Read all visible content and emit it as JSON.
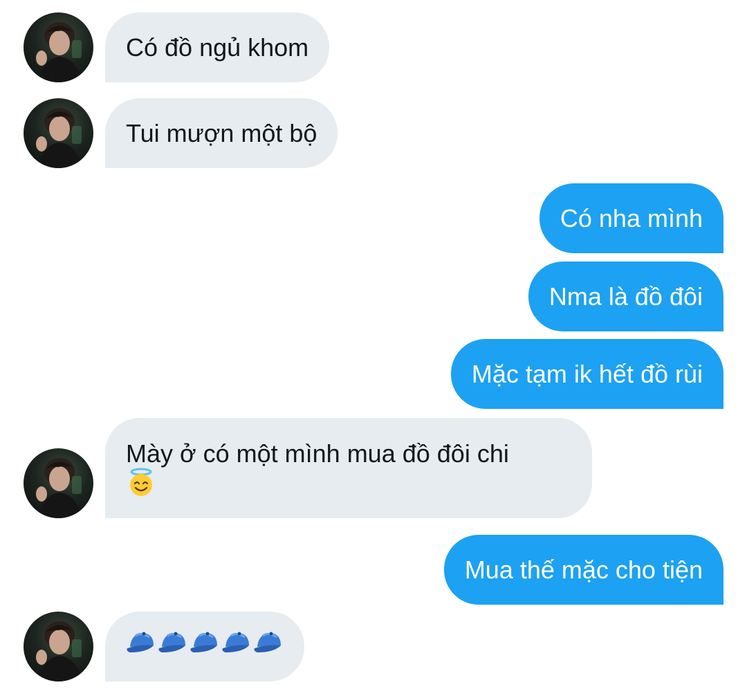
{
  "messages": [
    {
      "side": "incoming",
      "text": "Có đồ ngủ khom"
    },
    {
      "side": "incoming",
      "text": "Tui mượn một bộ"
    },
    {
      "side": "outgoing",
      "text": "Có nha mình"
    },
    {
      "side": "outgoing",
      "text": "Nma là đồ đôi"
    },
    {
      "side": "outgoing",
      "text": "Mặc tạm ik hết đồ rùi"
    },
    {
      "side": "incoming",
      "text": "Mày ở có một mình mua đồ đôi chi",
      "emoji": "smiling-face-with-halo"
    },
    {
      "side": "outgoing",
      "text": "Mua thế mặc cho tiện"
    },
    {
      "side": "incoming",
      "emoji": "billed-cap",
      "emoji_count": 5
    }
  ],
  "colors": {
    "incoming_bubble": "#e6ecf0",
    "outgoing_bubble": "#1da1f2",
    "incoming_text": "#14171a",
    "outgoing_text": "#ffffff"
  }
}
